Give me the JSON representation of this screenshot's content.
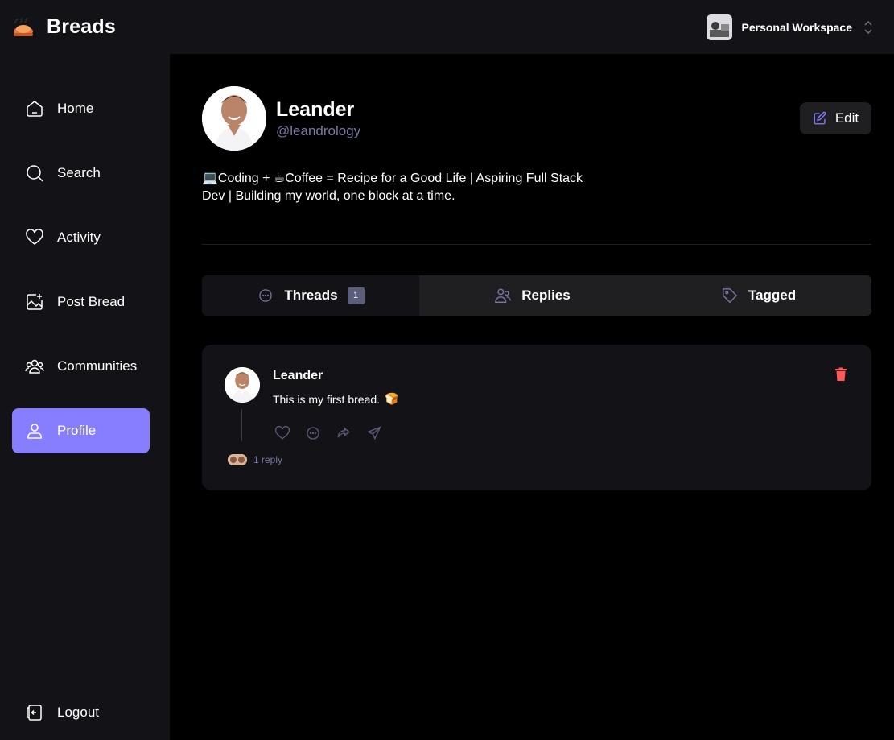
{
  "app": {
    "name": "Breads"
  },
  "workspace": {
    "name": "Personal Workspace"
  },
  "sidebar": {
    "items": [
      {
        "label": "Home",
        "icon": "home-icon"
      },
      {
        "label": "Search",
        "icon": "search-icon"
      },
      {
        "label": "Activity",
        "icon": "heart-icon"
      },
      {
        "label": "Post Bread",
        "icon": "image-plus-icon"
      },
      {
        "label": "Communities",
        "icon": "users-icon"
      },
      {
        "label": "Profile",
        "icon": "user-icon",
        "active": true
      }
    ],
    "logout": {
      "label": "Logout",
      "icon": "logout-icon"
    }
  },
  "profile": {
    "name": "Leander",
    "handle": "@leandrology",
    "bio_line1": "💻Coding + ☕Coffee = Recipe for a Good Life | Aspiring Full Stack",
    "bio_line2": "Dev | Building my world, one block at a time.",
    "edit_label": "Edit"
  },
  "tabs": [
    {
      "label": "Threads",
      "icon": "chat-bubble-icon",
      "count": "1",
      "active": true
    },
    {
      "label": "Replies",
      "icon": "users-icon"
    },
    {
      "label": "Tagged",
      "icon": "tag-icon"
    }
  ],
  "threads": [
    {
      "author": "Leander",
      "content": "This is my first bread.",
      "emoji": "🍞",
      "replies_label": "1 reply"
    }
  ],
  "colors": {
    "accent": "#877eff",
    "panel": "#121217",
    "tab_bg": "#1f1f22",
    "muted": "#7878a3",
    "danger": "#ff5a5a"
  }
}
